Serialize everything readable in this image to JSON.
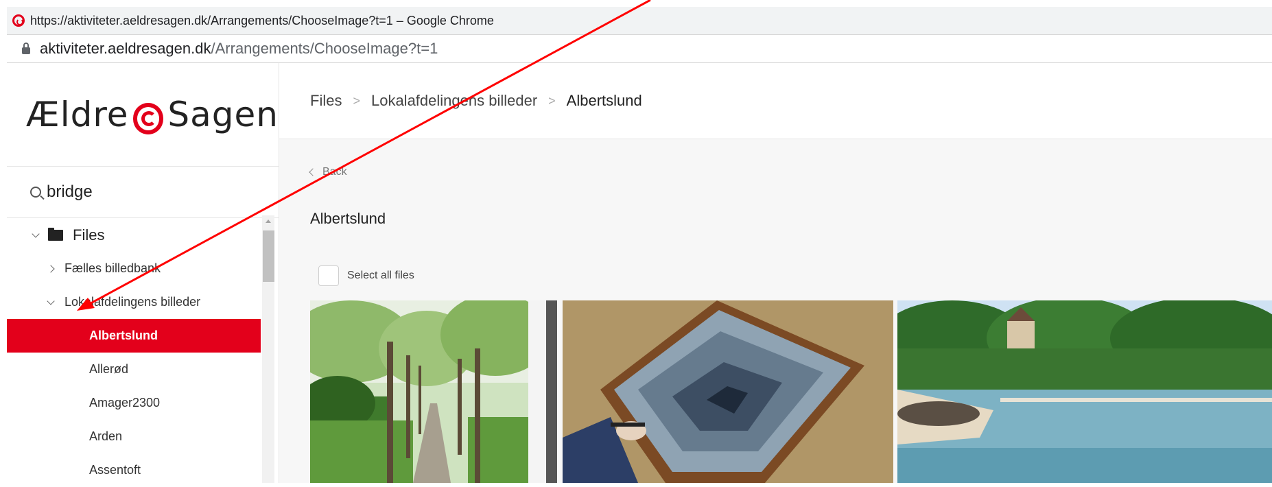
{
  "window": {
    "title": "https://aktiviteter.aeldresagen.dk/Arrangements/ChooseImage?t=1 – Google Chrome",
    "url_host": "aktiviteter.aeldresagen.dk",
    "url_path": "/Arrangements/ChooseImage?t=1"
  },
  "logo": {
    "left": "Ældre",
    "right": "Sagen"
  },
  "search": {
    "value": "bridge"
  },
  "tree": {
    "root": "Files",
    "items": [
      {
        "label": "Fælles billedbank"
      },
      {
        "label": "Lokalafdelingens billeder"
      }
    ],
    "children": [
      {
        "label": "Albertslund"
      },
      {
        "label": "Allerød"
      },
      {
        "label": "Amager2300"
      },
      {
        "label": "Arden"
      },
      {
        "label": "Assentoft"
      }
    ]
  },
  "breadcrumb": [
    "Files",
    "Lokalafdelingens billeder",
    "Albertslund"
  ],
  "back_label": "Back",
  "folder_title": "Albertslund",
  "select_all_label": "Select all files",
  "icons": [
    "search-icon",
    "folder-icon",
    "chevron-down-icon",
    "chevron-right-icon",
    "back-chevron-icon",
    "lock-icon"
  ],
  "colors": {
    "brand": "#e3001b",
    "annotation_arrow": "#ff0000"
  }
}
